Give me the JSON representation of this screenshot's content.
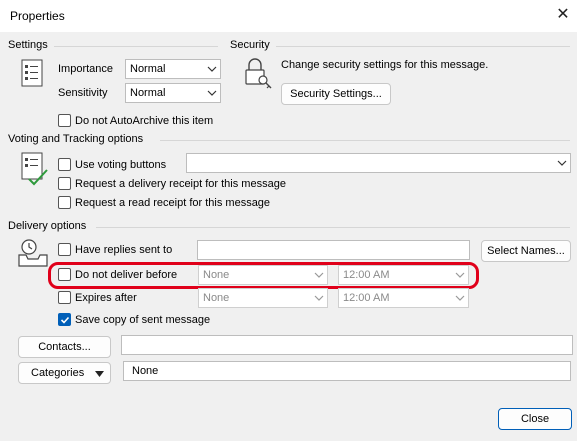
{
  "dialog": {
    "title": "Properties"
  },
  "settings": {
    "group_label": "Settings",
    "importance_label": "Importance",
    "importance_value": "Normal",
    "sensitivity_label": "Sensitivity",
    "sensitivity_value": "Normal",
    "autoarchive_label": "Do not AutoArchive this item",
    "autoarchive_checked": false
  },
  "security": {
    "group_label": "Security",
    "description": "Change security settings for this message.",
    "button_label": "Security Settings..."
  },
  "voting": {
    "group_label": "Voting and Tracking options",
    "use_voting_label": "Use voting buttons",
    "use_voting_value": "",
    "delivery_receipt_label": "Request a delivery receipt for this message",
    "read_receipt_label": "Request a read receipt for this message"
  },
  "delivery": {
    "group_label": "Delivery options",
    "have_replies_label": "Have replies sent to",
    "have_replies_value": "",
    "select_names_label": "Select Names...",
    "do_not_deliver_label": "Do not deliver before",
    "do_not_deliver_date": "None",
    "do_not_deliver_time": "12:00 AM",
    "expires_label": "Expires after",
    "expires_date": "None",
    "expires_time": "12:00 AM",
    "save_copy_label": "Save copy of sent message",
    "save_copy_checked": true
  },
  "contacts": {
    "button_label": "Contacts...",
    "value": ""
  },
  "categories": {
    "button_label": "Categories",
    "value": "None"
  },
  "footer": {
    "close_label": "Close"
  },
  "colors": {
    "accent": "#005fb8",
    "highlight": "#e0001a"
  }
}
